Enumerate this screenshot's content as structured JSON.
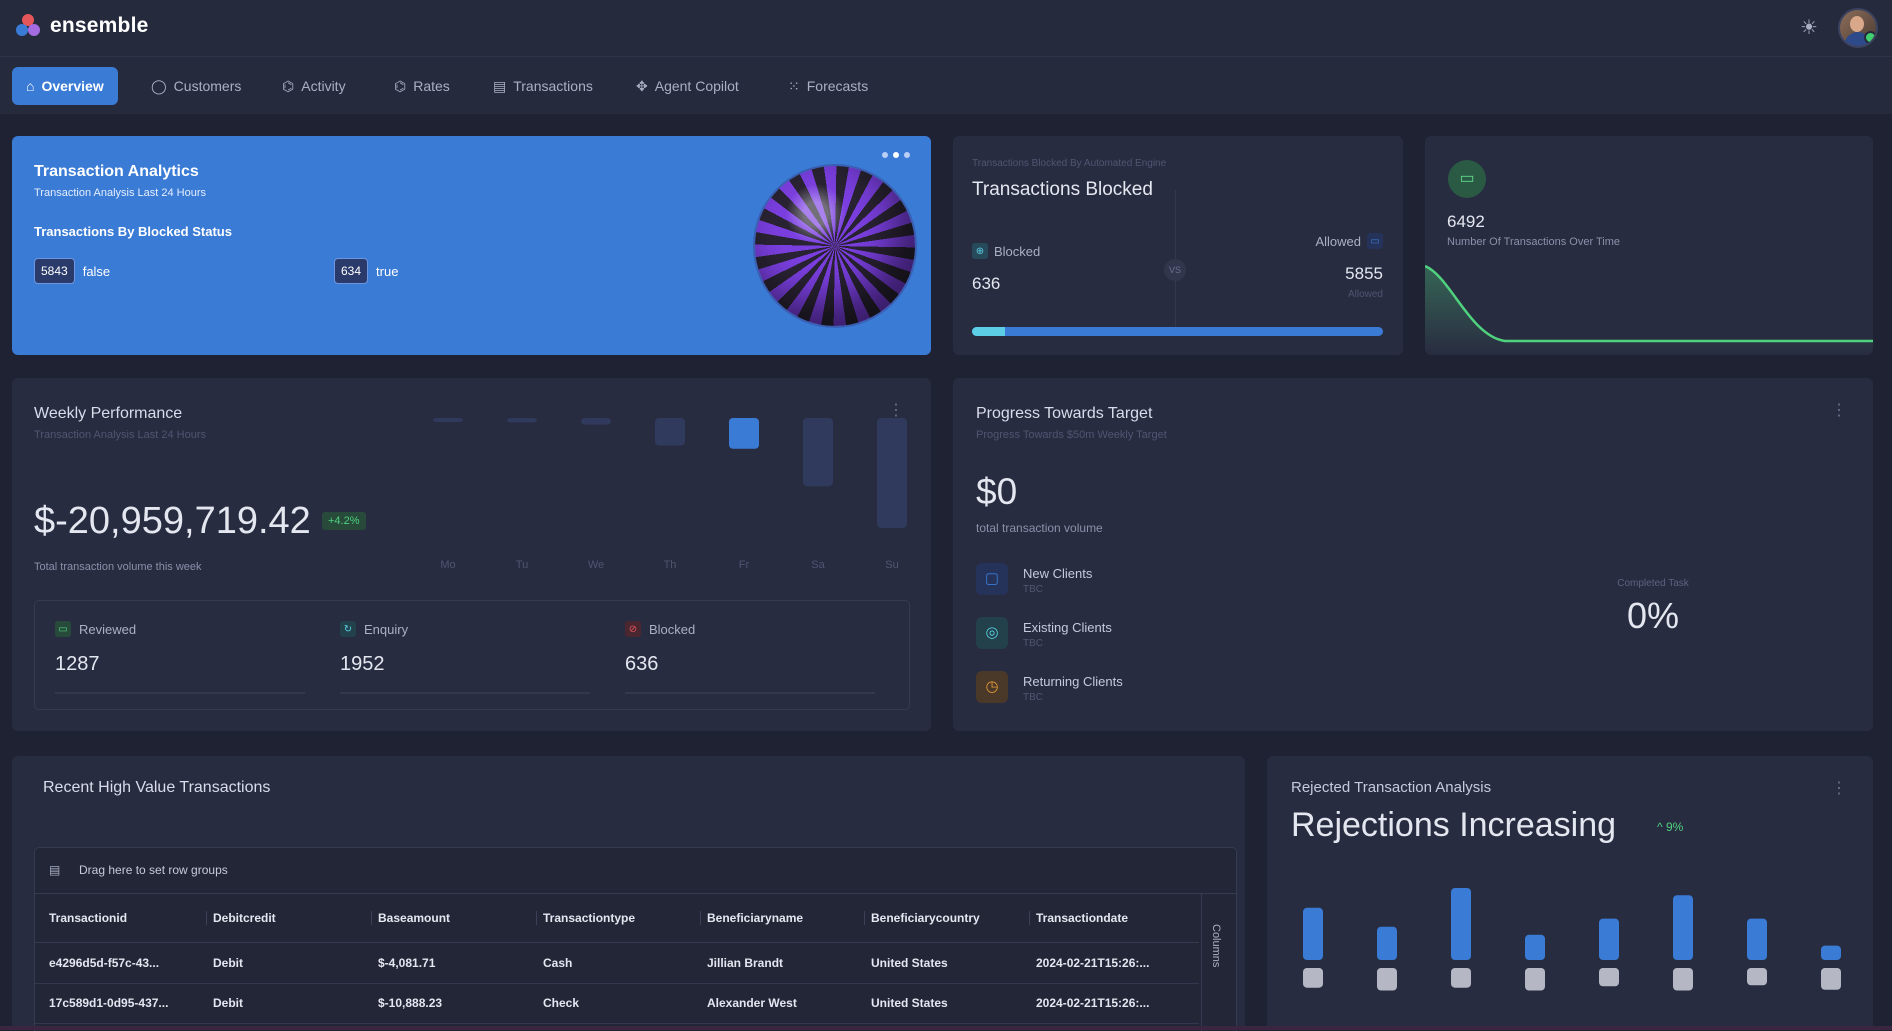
{
  "app": {
    "name": "ensemble"
  },
  "nav": {
    "tabs": [
      {
        "label": "Overview",
        "icon": "home-icon",
        "active": true
      },
      {
        "label": "Customers",
        "icon": "shield-icon"
      },
      {
        "label": "Activity",
        "icon": "activity-icon"
      },
      {
        "label": "Rates",
        "icon": "rates-icon"
      },
      {
        "label": "Transactions",
        "icon": "document-icon"
      },
      {
        "label": "Agent Copilot",
        "icon": "copilot-icon"
      },
      {
        "label": "Forecasts",
        "icon": "forecast-icon"
      }
    ]
  },
  "analytics": {
    "title": "Transaction Analytics",
    "subtitle": "Transaction Analysis Last 24 Hours",
    "section": "Transactions By Blocked Status",
    "false_count": "5843",
    "false_label": "false",
    "true_count": "634",
    "true_label": "true"
  },
  "blocked": {
    "super": "Transactions Blocked By Automated Engine",
    "title": "Transactions Blocked",
    "blocked_label": "Blocked",
    "blocked_value": "636",
    "allowed_label": "Allowed",
    "allowed_value": "5855",
    "allowed_sub": "Allowed",
    "vs": "VS",
    "blocked_share": 0.08
  },
  "txtime": {
    "value": "6492",
    "label": "Number Of Transactions Over Time",
    "accent": "#4fd17e"
  },
  "weekly": {
    "title": "Weekly Performance",
    "subtitle": "Transaction Analysis Last 24 Hours",
    "amount": "$-20,959,719.42",
    "change": "+4.2%",
    "caption": "Total transaction volume this week",
    "days": [
      "Mo",
      "Tu",
      "We",
      "Th",
      "Fr",
      "Sa",
      "Su"
    ],
    "day_values": [
      0.02,
      0.04,
      0.06,
      0.25,
      0.28,
      0.62,
      1.0
    ],
    "highlight_day": 4,
    "stats": [
      {
        "label": "Reviewed",
        "value": "1287",
        "icon": "card-icon",
        "color": "#4fd17e"
      },
      {
        "label": "Enquiry",
        "value": "1952",
        "icon": "enquiry-icon",
        "color": "#5ccfe6"
      },
      {
        "label": "Blocked",
        "value": "636",
        "icon": "blocked-icon",
        "color": "#e5565a"
      }
    ]
  },
  "progress": {
    "title": "Progress Towards Target",
    "subtitle": "Progress Towards $50m Weekly Target",
    "amount": "$0",
    "caption": "total transaction volume",
    "clients": [
      {
        "name": "New Clients",
        "sub": "TBC",
        "color": "#3a7bd5",
        "bg": "#25335a",
        "icon": "square-icon"
      },
      {
        "name": "Existing Clients",
        "sub": "TBC",
        "color": "#5ccfe6",
        "bg": "#22414a",
        "icon": "target-icon"
      },
      {
        "name": "Returning Clients",
        "sub": "TBC",
        "color": "#e59a3a",
        "bg": "#4a3828",
        "icon": "clock-icon"
      }
    ],
    "completed_label": "Completed Task",
    "completed_value": "0%"
  },
  "recent": {
    "title": "Recent High Value Transactions",
    "drag_text": "Drag here to set row groups",
    "columns_label": "Columns",
    "headers": [
      "Transactionid",
      "Debitcredit",
      "Baseamount",
      "Transactiontype",
      "Beneficiaryname",
      "Beneficiarycountry",
      "Transactiondate"
    ],
    "rows": [
      [
        "e4296d5d-f57c-43...",
        "Debit",
        "$-4,081.71",
        "Cash",
        "Jillian Brandt",
        "United States",
        "2024-02-21T15:26:..."
      ],
      [
        "17c589d1-0d95-437...",
        "Debit",
        "$-10,888.23",
        "Check",
        "Alexander West",
        "United States",
        "2024-02-21T15:26:..."
      ]
    ]
  },
  "rejected": {
    "title": "Rejected Transaction Analysis",
    "headline": "Rejections Increasing",
    "change": "^ 9%",
    "chart_data": {
      "type": "bar",
      "series": [
        {
          "values": [
            0.58,
            0.37,
            0.8,
            0.28,
            0.46,
            0.72,
            0.46,
            0.16
          ]
        },
        {
          "values": [
            0.22,
            0.3,
            0.22,
            0.3,
            0.18,
            0.3,
            0.15,
            0.28
          ]
        }
      ]
    }
  }
}
